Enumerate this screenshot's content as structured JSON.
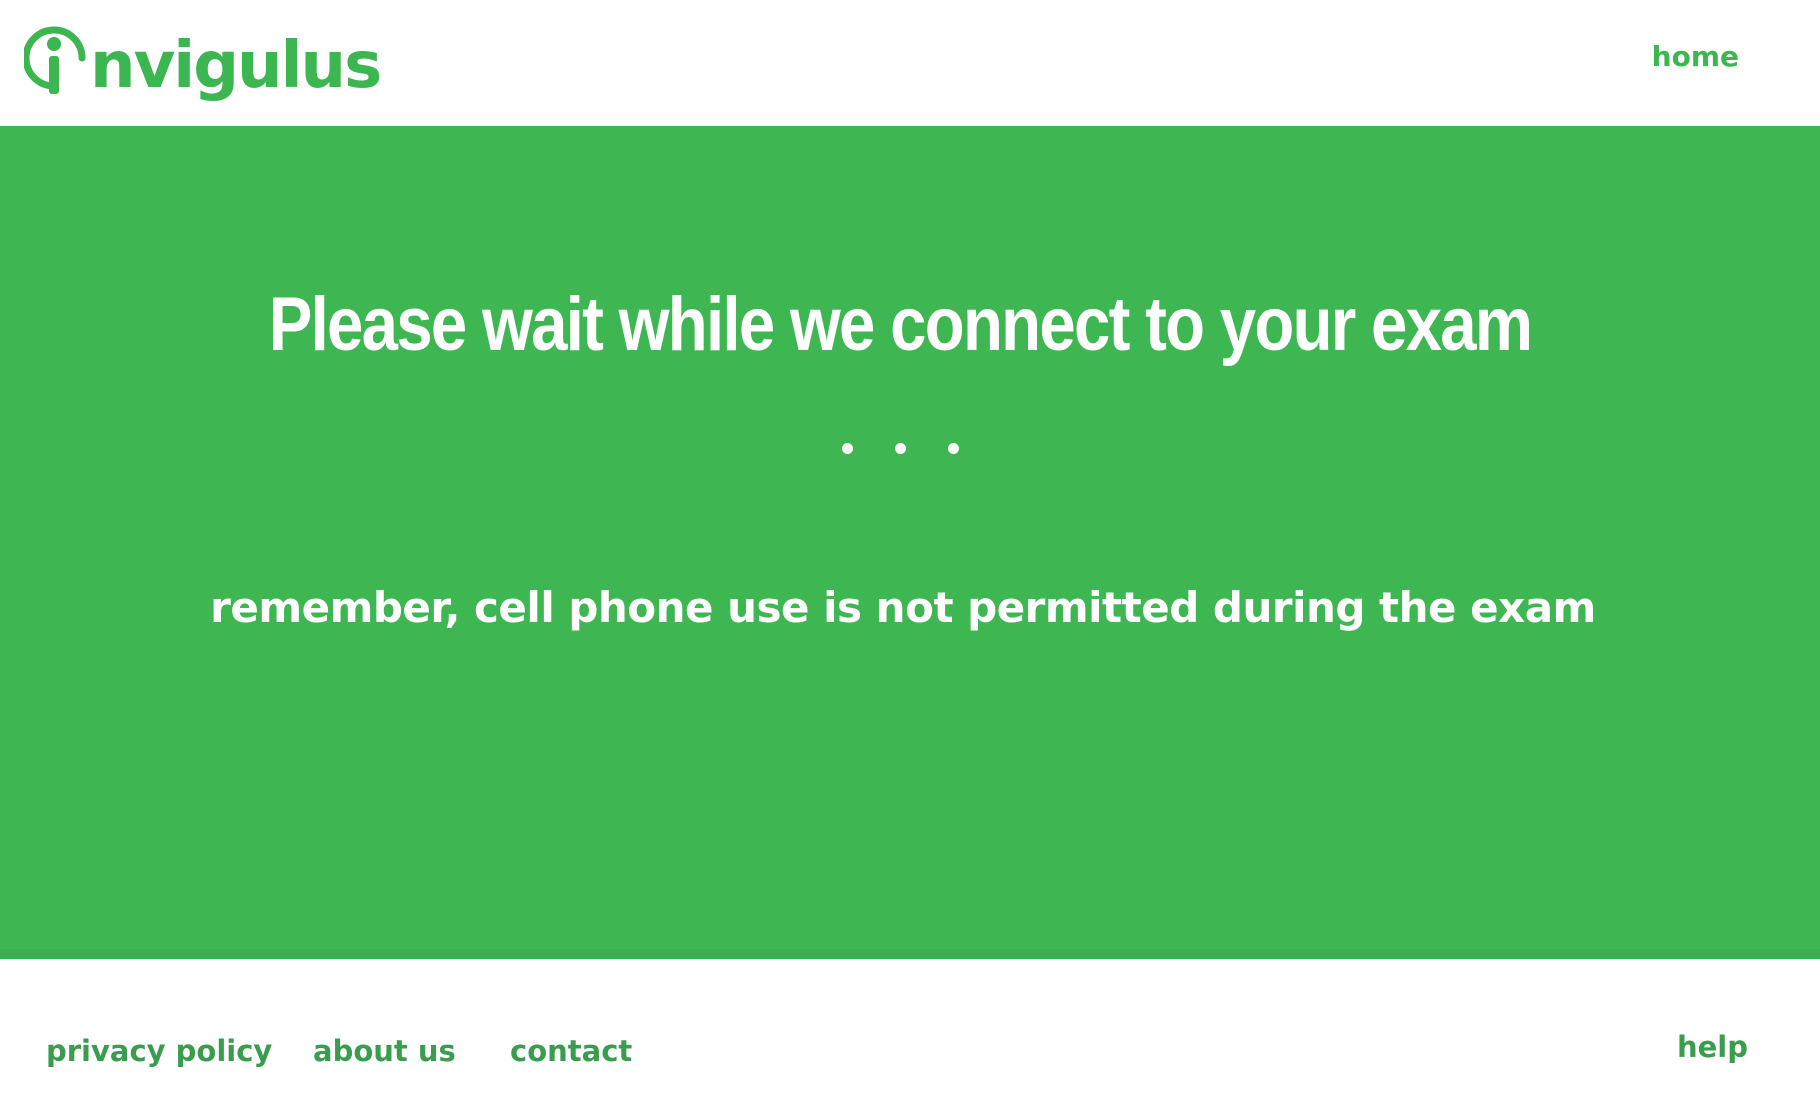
{
  "header": {
    "logo_text": "nvigulus",
    "logo_icon": "i-circle-logo-icon",
    "home_label": "home"
  },
  "main": {
    "title": "Please wait while we connect to your exam",
    "loading_dots": "• • •",
    "reminder": "remember, cell phone use is not permitted during the exam"
  },
  "footer": {
    "privacy_label": "privacy policy",
    "about_label": "about us",
    "contact_label": "contact",
    "help_label": "help"
  },
  "colors": {
    "brand_green": "#3cb651",
    "band_green": "#3eb753",
    "text_white": "#ffffff",
    "footer_link_green": "#3a9d4e"
  }
}
